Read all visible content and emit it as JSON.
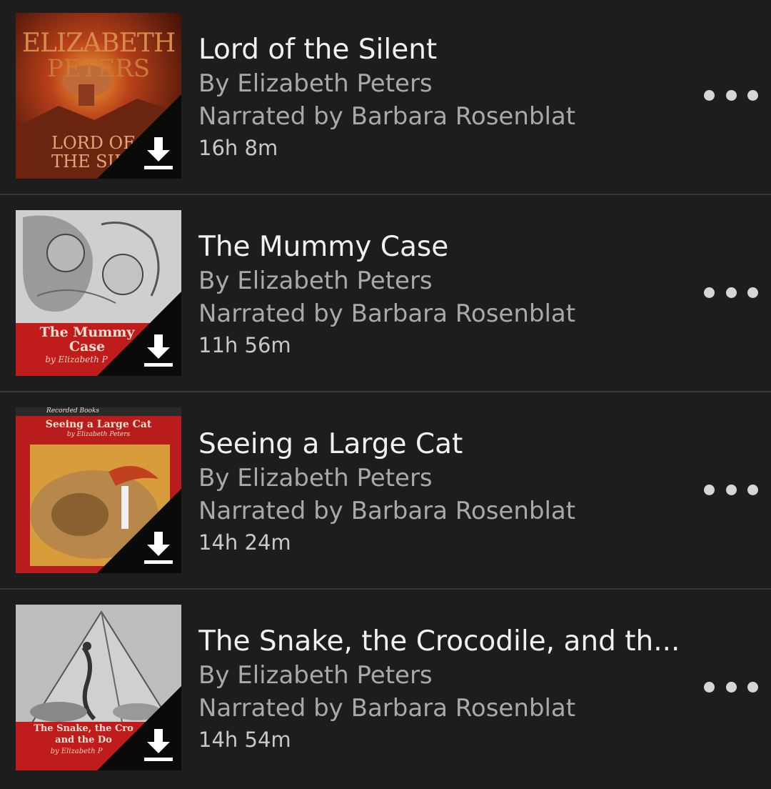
{
  "books": [
    {
      "title": "Lord of the Silent",
      "author": "By Elizabeth Peters",
      "narrator": "Narrated by Barbara Rosenblat",
      "duration": "16h 8m",
      "cover": {
        "line1": "ELIZABETH",
        "line2": "PETERS",
        "line3": "LORD OF",
        "line4": "THE SIL"
      }
    },
    {
      "title": "The Mummy Case",
      "author": "By Elizabeth Peters",
      "narrator": "Narrated by Barbara Rosenblat",
      "duration": "11h 56m",
      "cover": {
        "line1": "The Mummy",
        "line2": "Case",
        "line3": "by Elizabeth P"
      }
    },
    {
      "title": "Seeing a Large Cat",
      "author": "By Elizabeth Peters",
      "narrator": "Narrated by Barbara Rosenblat",
      "duration": "14h 24m",
      "cover": {
        "line1": "Recorded Books",
        "line2": "Seeing a Large Cat",
        "line3": "by Elizabeth Peters"
      }
    },
    {
      "title": "The Snake, the Crocodile, and th...",
      "author": "By Elizabeth Peters",
      "narrator": "Narrated by Barbara Rosenblat",
      "duration": "14h 54m",
      "cover": {
        "line1": "The Snake, the Cro",
        "line2": "and the Do",
        "line3": "by Elizabeth P"
      }
    }
  ],
  "colors": {
    "background": "#1d1d1d",
    "divider": "#3a3a3a",
    "title": "#f1f1f1",
    "subtitle": "#a9a9a9"
  },
  "icons": {
    "download": "download-icon",
    "more": "more-options-icon"
  }
}
